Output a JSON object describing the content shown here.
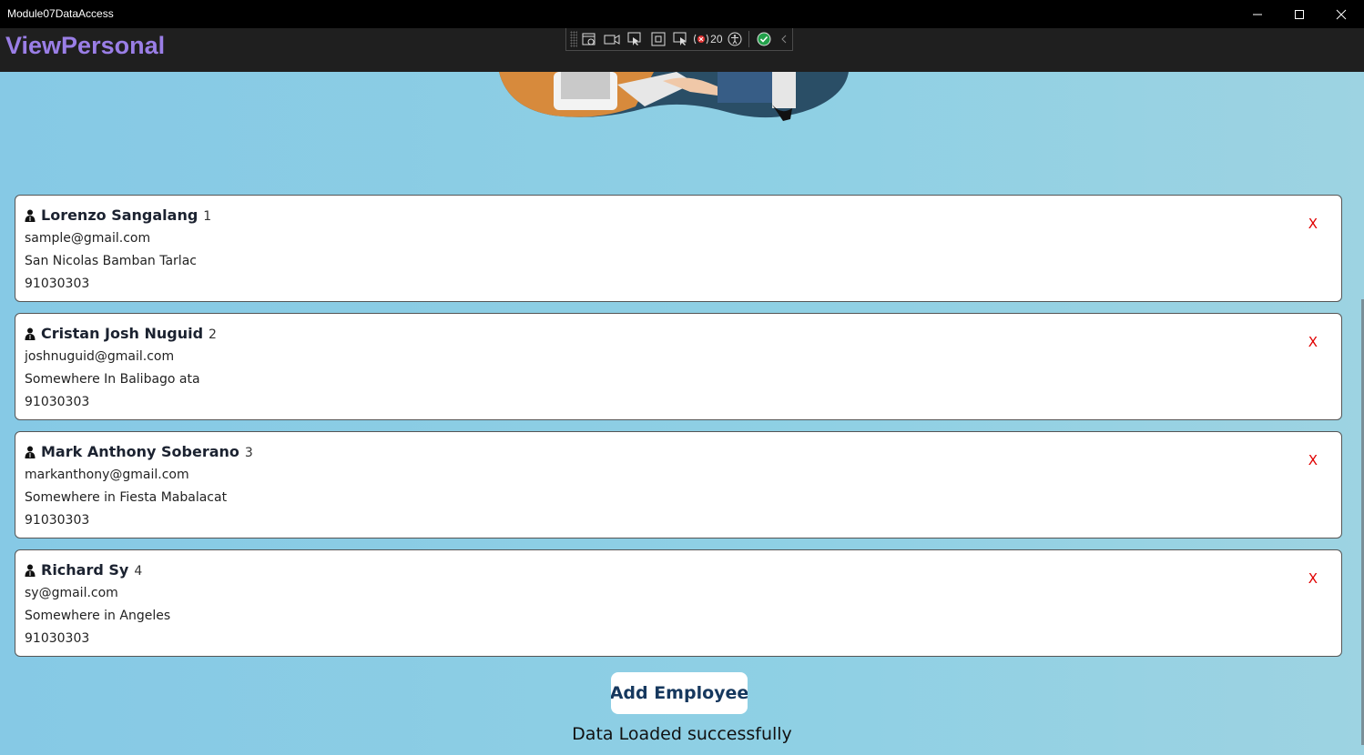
{
  "window": {
    "title": "Module07DataAccess"
  },
  "header": {
    "page_title": "ViewPersonal"
  },
  "devtools": {
    "frame_count": "20"
  },
  "employees": [
    {
      "name": "Lorenzo Sangalang",
      "id": "1",
      "email": "sample@gmail.com",
      "address": "San Nicolas Bamban Tarlac",
      "phone": "91030303",
      "delete_label": "X"
    },
    {
      "name": "Cristan Josh Nuguid",
      "id": "2",
      "email": "joshnuguid@gmail.com",
      "address": "Somewhere In Balibago ata",
      "phone": "91030303",
      "delete_label": "X"
    },
    {
      "name": "Mark Anthony Soberano",
      "id": "3",
      "email": "markanthony@gmail.com",
      "address": "Somewhere in Fiesta Mabalacat",
      "phone": "91030303",
      "delete_label": "X"
    },
    {
      "name": "Richard Sy",
      "id": "4",
      "email": "sy@gmail.com",
      "address": "Somewhere in Angeles",
      "phone": "91030303",
      "delete_label": "X"
    }
  ],
  "actions": {
    "add_label": "Add Employee"
  },
  "status": {
    "message": "Data Loaded successfully"
  },
  "colors": {
    "accent_title": "#9a7ee6",
    "background": "#8fd0e4",
    "delete": "#e00000",
    "button_text": "#16385e"
  }
}
